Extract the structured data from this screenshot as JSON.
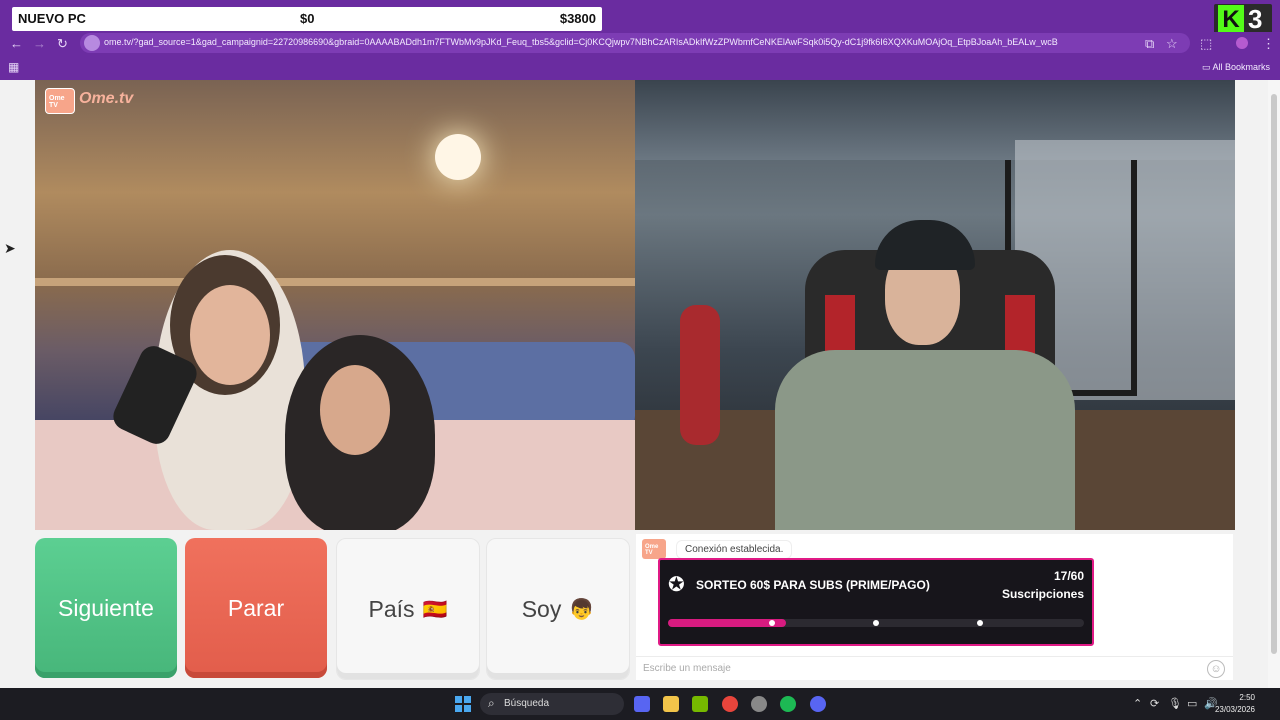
{
  "overlay": {
    "goal_title": "NUEVO PC",
    "goal_current": "$0",
    "goal_target": "$3800",
    "kick_badge_letter": "K",
    "kick_badge_number": "3"
  },
  "browser": {
    "url": "ome.tv/?gad_source=1&gad_campaignid=22720986690&gbraid=0AAAABADdh1m7FTWbMv9pJKd_Feuq_tbs5&gclid=Cj0KCQjwpv7NBhCzARIsADkIfWzZPWbmfCeNKElAwFSqk0i5Qy-dC1j9fk6I6XQXKuMOAjOq_EtpBJoaAh_bEALw_wcB",
    "bookmarks_label": "All Bookmarks"
  },
  "ometv": {
    "logo_icon_text": "Ome TV",
    "logo_text": "Ome.tv",
    "buttons": {
      "next": "Siguiente",
      "stop": "Parar",
      "country": "País",
      "country_flag": "🇪🇸",
      "gender": "Soy",
      "gender_emoji": "👦"
    },
    "chat": {
      "system_icon_text": "Ome TV",
      "system_message": "Conexión establecida.",
      "input_placeholder": "Escribe un mensaje"
    }
  },
  "promo": {
    "title": "SORTEO 60$ PARA SUBS (PRIME/PAGO)",
    "count": "17/60",
    "label": "Suscripciones",
    "progress_fraction": 0.283,
    "milestone_fractions": [
      0.25,
      0.5,
      0.75
    ],
    "accent_color": "#e01a86"
  },
  "taskbar": {
    "search_label": "Búsqueda",
    "time": "2:50",
    "date": "23/03/2026"
  },
  "colors": {
    "browser_chrome": "#6a2ca0",
    "next_button": "#47b67a",
    "stop_button": "#e25d4b"
  }
}
